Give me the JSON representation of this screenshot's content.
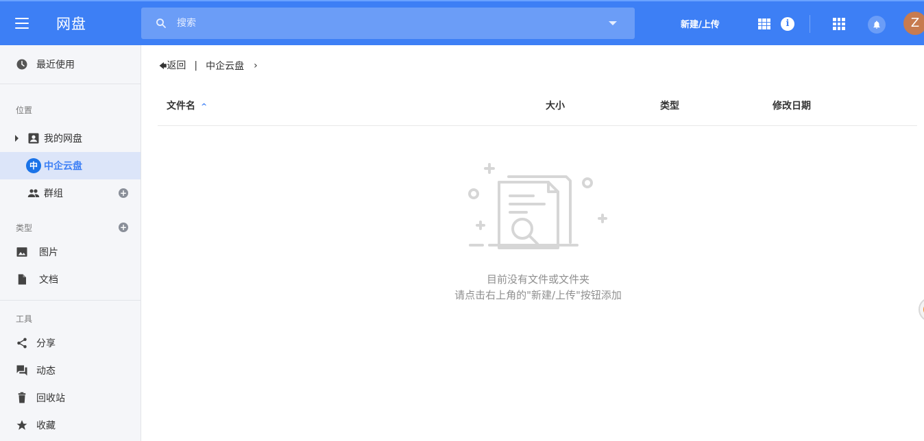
{
  "header": {
    "menu_icon": "hamburger-menu-icon",
    "app_title": "网盘",
    "search": {
      "placeholder": "搜索",
      "icon": "search-icon"
    },
    "new_upload_label": "新建/上传",
    "icons": [
      "grid-view-icon",
      "info-icon",
      "apps-icon",
      "bell-icon"
    ],
    "avatar_initial": "Z",
    "colors": {
      "bar": "#3d7ff5",
      "search_bg": "#6b9df7"
    }
  },
  "sidebar": {
    "recent": {
      "label": "最近使用",
      "icon": "clock-icon"
    },
    "location_section": "位置",
    "my_drive": {
      "label": "我的网盘",
      "icon": "account-box-icon"
    },
    "enterprise": {
      "badge": "中",
      "label": "中企云盘"
    },
    "groups": {
      "label": "群组",
      "icon": "people-icon"
    },
    "types_section": "类型",
    "images": {
      "label": "图片",
      "icon": "image-icon"
    },
    "documents": {
      "label": "文档",
      "icon": "document-icon"
    },
    "tools_section": "工具",
    "share": {
      "label": "分享",
      "icon": "share-icon"
    },
    "activity": {
      "label": "动态",
      "icon": "forum-icon"
    },
    "trash": {
      "label": "回收站",
      "icon": "trash-icon"
    },
    "favorites": {
      "label": "收藏",
      "icon": "star-icon"
    }
  },
  "breadcrumb": {
    "back_label": "返回",
    "separator": "|",
    "current": "中企云盘",
    "chevron": "›"
  },
  "table": {
    "columns": {
      "name": "文件名",
      "size": "大小",
      "type": "类型",
      "modified": "修改日期"
    },
    "sort_indicator": "^"
  },
  "empty_state": {
    "line1": "目前没有文件或文件夹",
    "line2": "请点击右上角的\"新建/上传\"按钮添加"
  }
}
